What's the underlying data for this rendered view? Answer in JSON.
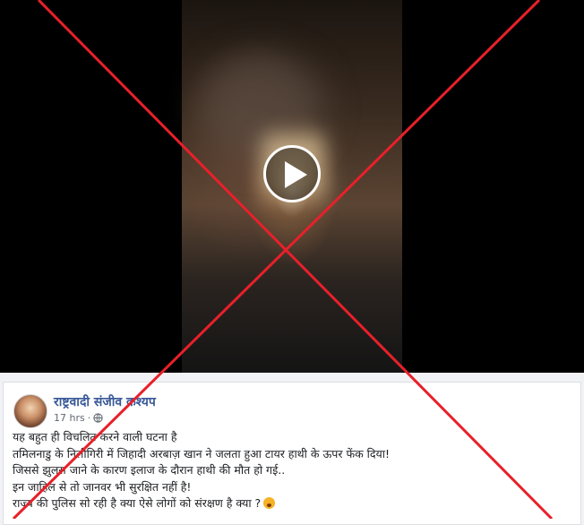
{
  "post": {
    "author": "राष्ट्रवादी संजीव कश्यप",
    "time": "17 hrs",
    "lines": [
      "यह बहुत ही विचलित करने वाली घटना है",
      "तमिलनाडु के निलीगिरी में जिहादी अरबाज़ खान ने जलता हुआ टायर हाथी के ऊपर फेंक दिया!",
      "जिससे झुलस जाने के कारण इलाज के दौरान हाथी की मौत हो गई..",
      "इन जाहिल से तो जानवर भी सुरक्षित नहीं है!",
      "राज्य की पुलिस सो रही है क्या ऐसे लोगों को संरक्षण है क्या ?"
    ]
  },
  "colors": {
    "cross": "#e8202a",
    "author_link": "#385898"
  },
  "icons": {
    "play": "play-icon",
    "privacy": "globe-icon",
    "emoji": "surprised-face-icon"
  }
}
